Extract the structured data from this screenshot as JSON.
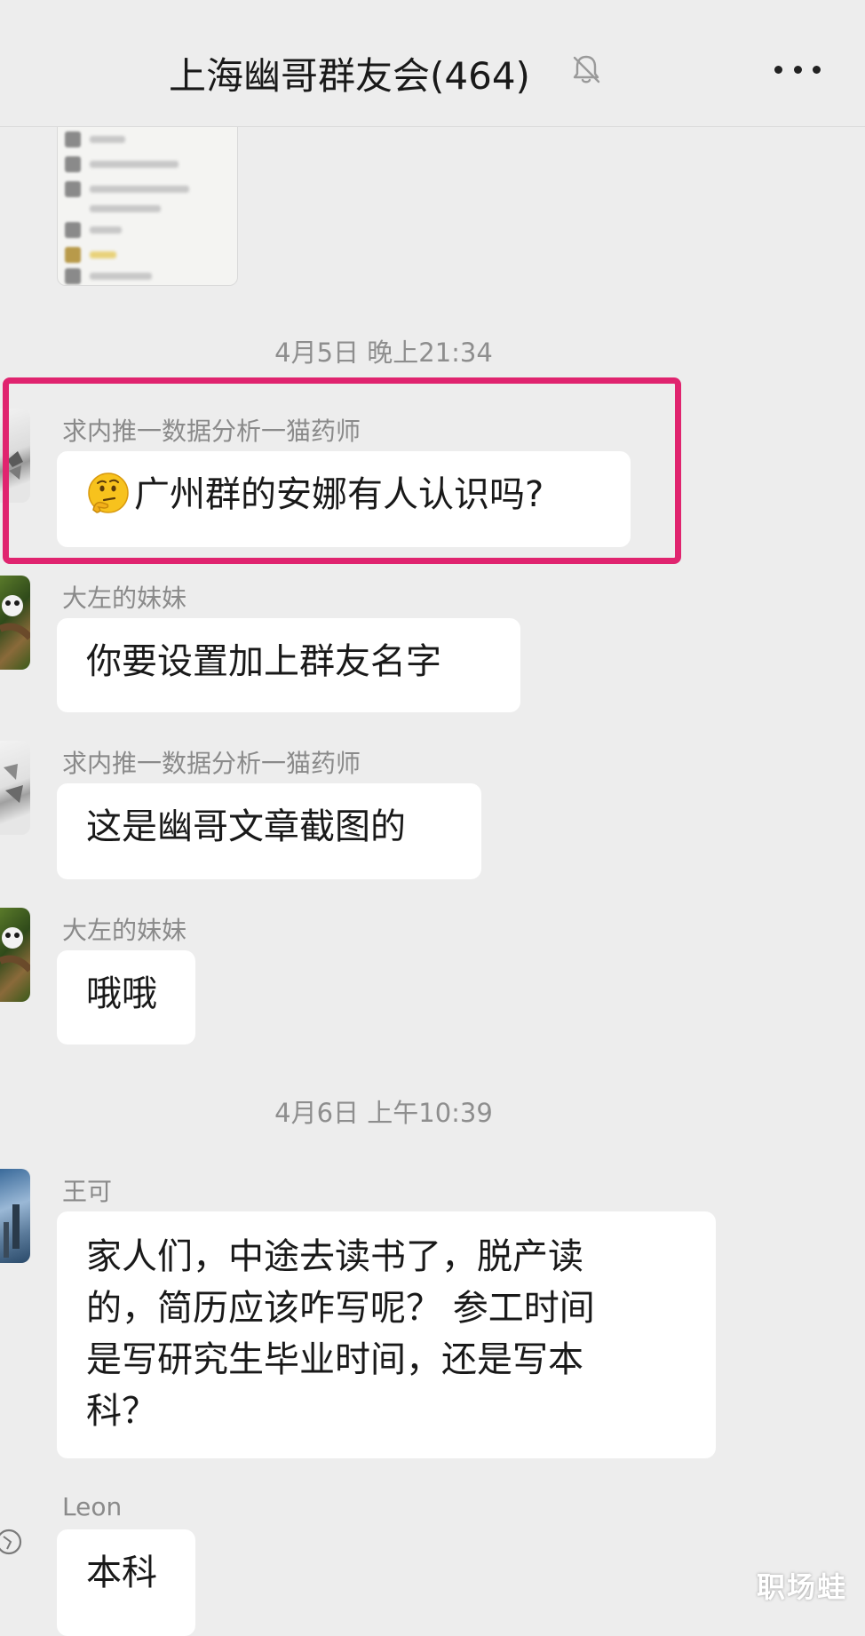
{
  "header": {
    "title": "上海幽哥群友会(464)",
    "mute_icon": "bell-off-icon",
    "more_icon": "more-dots-icon"
  },
  "messages": [
    {
      "type": "timestamp",
      "text": "4月5日 晚上21:34"
    },
    {
      "type": "text",
      "sender": "求内推一数据分析一猫药师",
      "text": "广州群的安娜有人认识吗?",
      "emoji": "thinking-face-emoji",
      "highlighted": true
    },
    {
      "type": "text",
      "sender": "大左的妹妹",
      "text": "你要设置加上群友名字"
    },
    {
      "type": "text",
      "sender": "求内推一数据分析一猫药师",
      "text": "这是幽哥文章截图的"
    },
    {
      "type": "text",
      "sender": "大左的妹妹",
      "text": "哦哦"
    },
    {
      "type": "timestamp",
      "text": "4月6日 上午10:39"
    },
    {
      "type": "text",
      "sender": "王可",
      "lines": [
        "家人们，中途去读书了，脱产读",
        "的，简历应该咋写呢？  参工时间",
        "是写研究生毕业时间，还是写本",
        "科？"
      ]
    },
    {
      "type": "text",
      "sender": "Leon",
      "text": "本科"
    }
  ],
  "watermark": "职场蛙",
  "colors": {
    "background": "#ededed",
    "bubble": "#ffffff",
    "highlight": "#e0246f",
    "meta_text": "#8e8e8e"
  }
}
